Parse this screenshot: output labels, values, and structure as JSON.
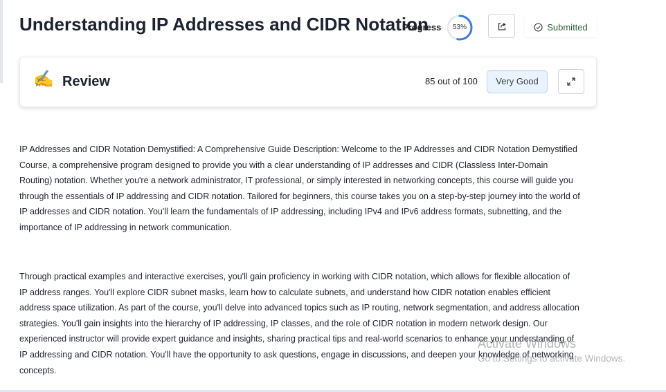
{
  "page": {
    "title": "Understanding IP Addresses and CIDR Notation"
  },
  "header": {
    "progress_label": "Progress",
    "progress_percent": 53,
    "progress_text": "53%",
    "share_icon": "share-icon",
    "status_label": "Submitted",
    "status_icon": "check-circle-icon"
  },
  "review": {
    "icon": "writing-hand-icon",
    "title": "Review",
    "score_text": "85 out of 100",
    "grade": "Very Good",
    "expand_icon": "expand-icon"
  },
  "content": {
    "paragraphs": [
      "IP Addresses and CIDR Notation Demystified: A Comprehensive Guide Description: Welcome to the IP Addresses and CIDR Notation Demystified Course, a comprehensive program designed to provide you with a clear understanding of IP addresses and CIDR (Classless Inter-Domain Routing) notation. Whether you're a network administrator, IT professional, or simply interested in networking concepts, this course will guide you through the essentials of IP addressing and CIDR notation. Tailored for beginners, this course takes you on a step-by-step journey into the world of IP addresses and CIDR notation. You'll learn the fundamentals of IP addressing, including IPv4 and IPv6 address formats, subnetting, and the importance of IP addressing in network communication.",
      "Through practical examples and interactive exercises, you'll gain proficiency in working with CIDR notation, which allows for flexible allocation of IP address ranges. You'll explore CIDR subnet masks, learn how to calculate subnets, and understand how CIDR notation enables efficient address space utilization. As part of the course, you'll delve into advanced topics such as IP routing, network segmentation, and address allocation strategies. You'll gain insights into the hierarchy of IP addressing, IP classes, and the role of CIDR notation in modern network design. Our experienced instructor will provide expert guidance and insights, sharing practical tips and real-world scenarios to enhance your understanding of IP addressing and CIDR notation. You'll have the opportunity to ask questions, engage in discussions, and deepen your knowledge of networking concepts."
    ]
  },
  "watermark": {
    "title": "Activate Windows",
    "subtitle": "Go to Settings to activate Windows."
  },
  "colors": {
    "progress_ring": "#3b7be0",
    "progress_track": "#e6e9ee",
    "grade_bg": "#eaf3fd",
    "grade_border": "#b9d3f2",
    "status_text": "#2f5d3a"
  }
}
